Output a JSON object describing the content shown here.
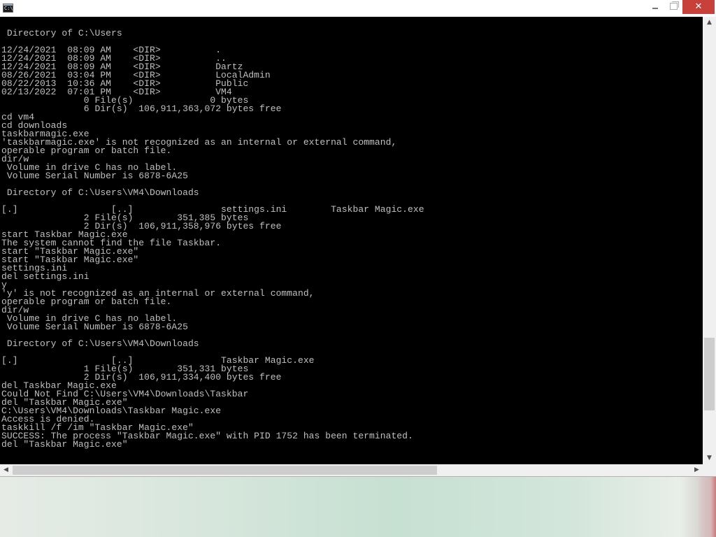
{
  "window": {
    "icon_text": "C:\\",
    "controls": {
      "minimize": "",
      "maximize": "",
      "close": "✕"
    }
  },
  "console": {
    "lines": [
      "",
      " Directory of C:\\Users",
      "",
      "12/24/2021  08:09 AM    <DIR>          .",
      "12/24/2021  08:09 AM    <DIR>          ..",
      "12/24/2021  08:09 AM    <DIR>          Dartz",
      "08/26/2021  03:04 PM    <DIR>          LocalAdmin",
      "08/22/2013  10:36 AM    <DIR>          Public",
      "02/13/2022  07:01 PM    <DIR>          VM4",
      "               0 File(s)              0 bytes",
      "               6 Dir(s)  106,911,363,072 bytes free",
      "cd vm4",
      "cd downloads",
      "taskbarmagic.exe",
      "'taskbarmagic.exe' is not recognized as an internal or external command,",
      "operable program or batch file.",
      "dir/w",
      " Volume in drive C has no label.",
      " Volume Serial Number is 6878-6A25",
      "",
      " Directory of C:\\Users\\VM4\\Downloads",
      "",
      "[.]                 [..]                settings.ini        Taskbar Magic.exe",
      "               2 File(s)        351,385 bytes",
      "               2 Dir(s)  106,911,358,976 bytes free",
      "start Taskbar Magic.exe",
      "The system cannot find the file Taskbar.",
      "start \"Taskbar Magic.exe\"",
      "start \"Taskbar Magic.exe\"",
      "settings.ini",
      "del settings.ini",
      "y",
      "'y' is not recognized as an internal or external command,",
      "operable program or batch file.",
      "dir/w",
      " Volume in drive C has no label.",
      " Volume Serial Number is 6878-6A25",
      "",
      " Directory of C:\\Users\\VM4\\Downloads",
      "",
      "[.]                 [..]                Taskbar Magic.exe",
      "               1 File(s)        351,331 bytes",
      "               2 Dir(s)  106,911,334,400 bytes free",
      "del Taskbar Magic.exe",
      "Could Not Find C:\\Users\\VM4\\Downloads\\Taskbar",
      "del \"Taskbar Magic.exe\"",
      "C:\\Users\\VM4\\Downloads\\Taskbar Magic.exe",
      "Access is denied.",
      "taskkill /f /im \"Taskbar Magic.exe\"",
      "SUCCESS: The process \"Taskbar Magic.exe\" with PID 1752 has been terminated.",
      "del \"Taskbar Magic.exe\""
    ]
  },
  "scrollbars": {
    "up_arrow": "▲",
    "down_arrow": "▼",
    "left_arrow": "◀",
    "right_arrow": "▶",
    "vertical_position": 0.88,
    "horizontal_position": 0.0
  },
  "colors": {
    "console_bg": "#000000",
    "console_text": "#c0c0c0",
    "close_button": "#c7413a"
  }
}
